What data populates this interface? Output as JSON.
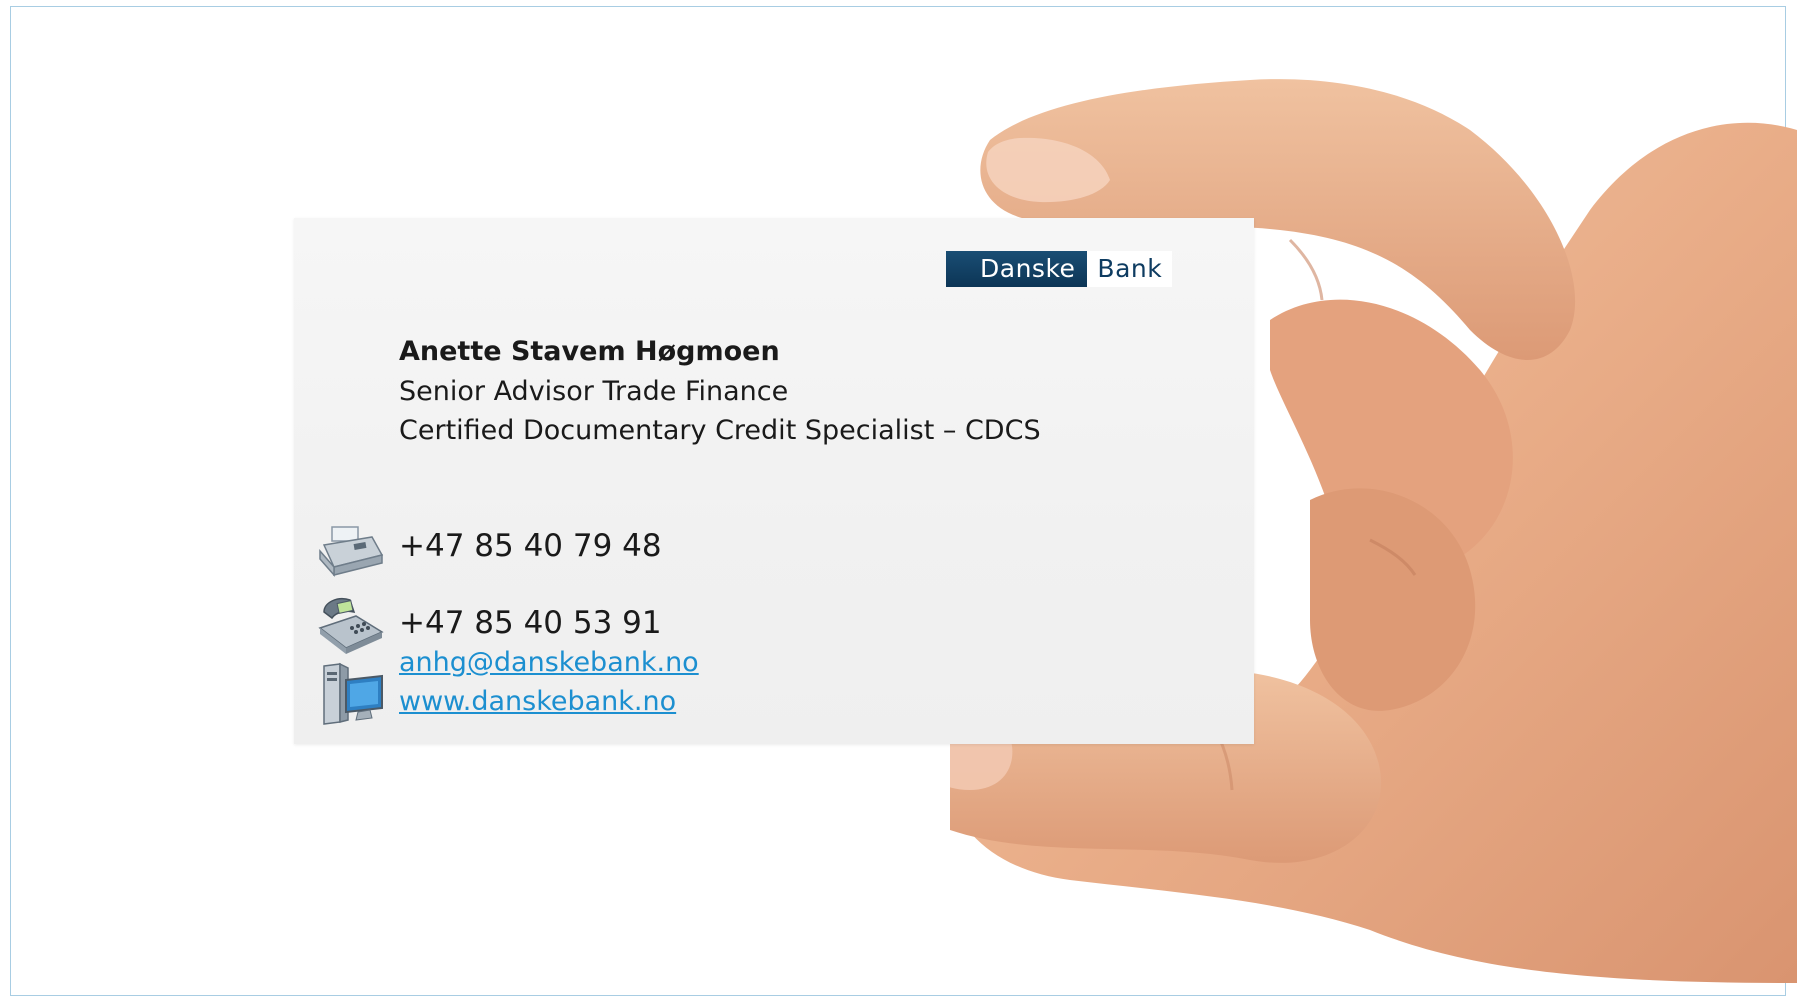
{
  "card": {
    "logo": {
      "left_word": "Danske",
      "right_word": "Bank"
    },
    "name": "Anette Stavem Høgmoen",
    "title_line_1": "Senior Advisor Trade Finance",
    "title_line_2": "Certified Documentary Credit Specialist – CDCS",
    "fax_number": "+47 85 40 79 48",
    "phone_number": "+47 85 40 53 91",
    "email": "anhg@danskebank.no",
    "website": "www.danskebank.no"
  },
  "icons": {
    "fax": "fax-machine-icon",
    "phone": "desk-phone-icon",
    "computer": "computer-icon"
  },
  "colors": {
    "brand_dark_blue": "#0e3c61",
    "link_blue": "#1c8fd0"
  }
}
